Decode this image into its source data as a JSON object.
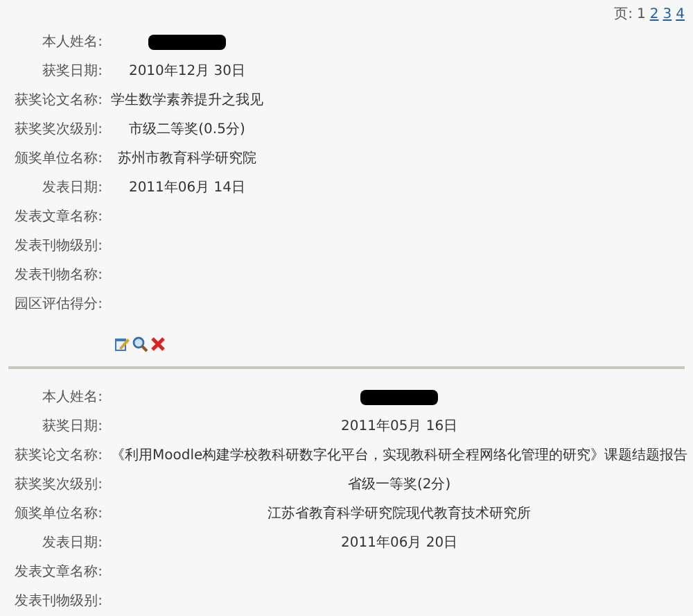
{
  "pager": {
    "label": "页:",
    "pages": [
      {
        "label": "1",
        "selected": true
      },
      {
        "label": "2",
        "selected": false
      },
      {
        "label": "3",
        "selected": false
      },
      {
        "label": "4",
        "selected": false
      }
    ]
  },
  "records": [
    {
      "fields": [
        {
          "label": "本人姓名:",
          "kind": "redacted"
        },
        {
          "label": "获奖日期:",
          "kind": "text",
          "value": "2010年12月 30日"
        },
        {
          "label": "获奖论文名称:",
          "kind": "text",
          "value": "学生数学素养提升之我见"
        },
        {
          "label": "获奖奖次级别:",
          "kind": "text",
          "value": "市级二等奖(0.5分)"
        },
        {
          "label": "颁奖单位名称:",
          "kind": "text",
          "value": "苏州市教育科学研究院"
        },
        {
          "label": "发表日期:",
          "kind": "text",
          "value": "2011年06月 14日"
        },
        {
          "label": "发表文章名称:",
          "kind": "text"
        },
        {
          "label": "发表刊物级别:",
          "kind": "text"
        },
        {
          "label": "发表刊物名称:",
          "kind": "text"
        },
        {
          "label": "园区评估得分:",
          "kind": "text"
        }
      ],
      "actions": [
        {
          "kind": "edit"
        },
        {
          "kind": "view"
        },
        {
          "kind": "delete"
        }
      ]
    },
    {
      "fields": [
        {
          "label": "本人姓名:",
          "kind": "redacted"
        },
        {
          "label": "获奖日期:",
          "kind": "text",
          "value": "2011年05月 16日"
        },
        {
          "label": "获奖论文名称:",
          "kind": "text",
          "value": "《利用Moodle构建学校教科研数字化平台，实现教科研全程网络化管理的研究》课题结题报告"
        },
        {
          "label": "获奖奖次级别:",
          "kind": "text",
          "value": "省级一等奖(2分)"
        },
        {
          "label": "颁奖单位名称:",
          "kind": "text",
          "value": "江苏省教育科学研究院现代教育技术研究所"
        },
        {
          "label": "发表日期:",
          "kind": "text",
          "value": "2011年06月 20日"
        },
        {
          "label": "发表文章名称:",
          "kind": "text"
        },
        {
          "label": "发表刊物级别:",
          "kind": "text"
        }
      ]
    }
  ]
}
